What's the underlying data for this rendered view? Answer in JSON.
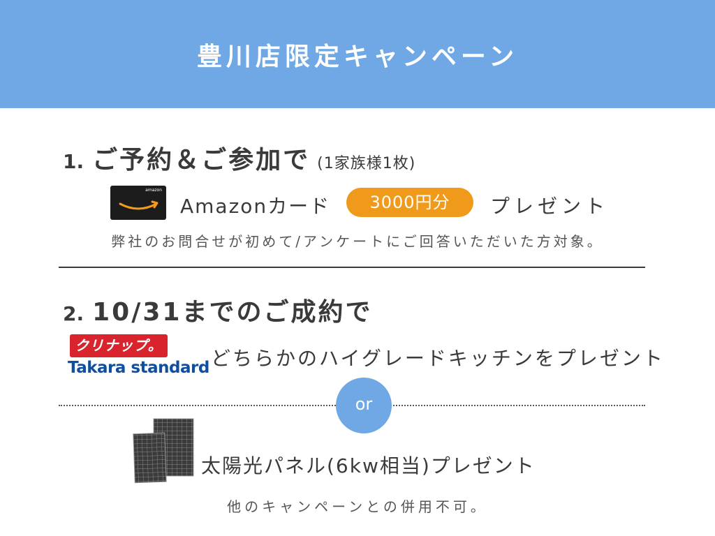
{
  "header": {
    "title": "豊川店限定キャンペーン"
  },
  "section1": {
    "number": "1.",
    "heading": "ご予約＆ご参加で",
    "note": "(1家族様1枚)",
    "card_brand": "amazon",
    "amazon_label": "Amazonカード",
    "amount_badge": "3000円分",
    "present": "プレゼント",
    "condition": "弊社のお問合せが初めて/アンケートにご回答いただいた方対象。"
  },
  "section2": {
    "number": "2.",
    "heading": "10/31までのご成約で",
    "cleanup_logo": "クリナップ。",
    "takara_logo": "Takara standard",
    "kitchen_text": "どちらかのハイグレードキッチンをプレゼント",
    "or_label": "or",
    "solar_text": "太陽光パネル(6kw相当)プレゼント",
    "footer_note": "他のキャンペーンとの併用不可。"
  },
  "colors": {
    "header_bg": "#6fa8e4",
    "badge_orange": "#ef9a1a",
    "cleanup_red": "#d9232d",
    "takara_blue": "#0d4fa0",
    "text_dark": "#3a3a3a"
  }
}
